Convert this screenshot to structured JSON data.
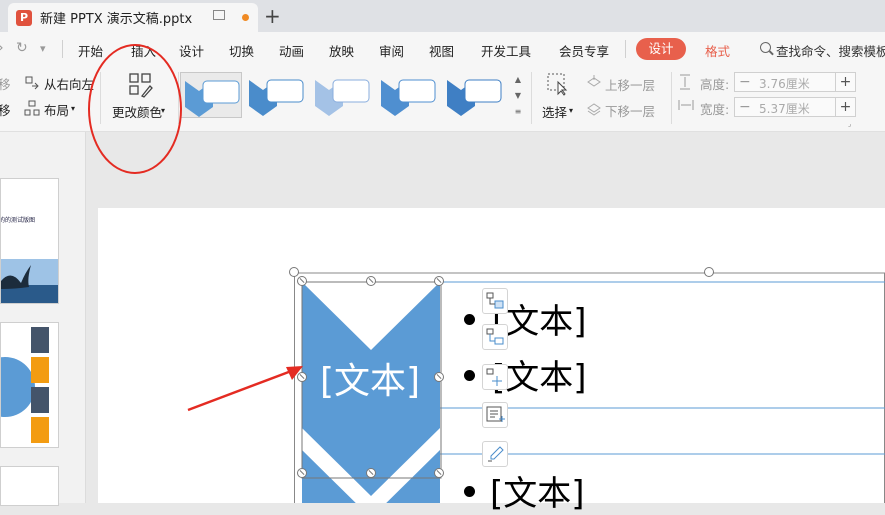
{
  "tab": {
    "title": "新建 PPTX 演示文稿.pptx",
    "app_icon": "P"
  },
  "menu": {
    "items": [
      "开始",
      "插入",
      "设计",
      "切换",
      "动画",
      "放映",
      "审阅",
      "视图",
      "开发工具",
      "会员专享"
    ],
    "context_tabs": [
      "设计",
      "格式"
    ],
    "search_placeholder": "查找命令、搜索模板"
  },
  "ribbon": {
    "left_partial": [
      "移",
      "移"
    ],
    "rtl_label": "从右向左",
    "layout_label": "布局",
    "change_color_label": "更改颜色",
    "select_label": "选择",
    "bring_forward_label": "上移一层",
    "send_backward_label": "下移一层",
    "height_label": "高度:",
    "height_value": "3.76厘米",
    "width_label": "宽度:",
    "width_value": "5.37厘米"
  },
  "thumbnails": {
    "caption": "的的测试版图"
  },
  "slide": {
    "shape_text": "[文本]",
    "bullets": [
      "[文本]",
      "[文本]",
      "[文本]"
    ]
  },
  "colors": {
    "accent": "#e8604c",
    "shape_blue": "#5b9bd5",
    "annotation_red": "#e42b22"
  }
}
